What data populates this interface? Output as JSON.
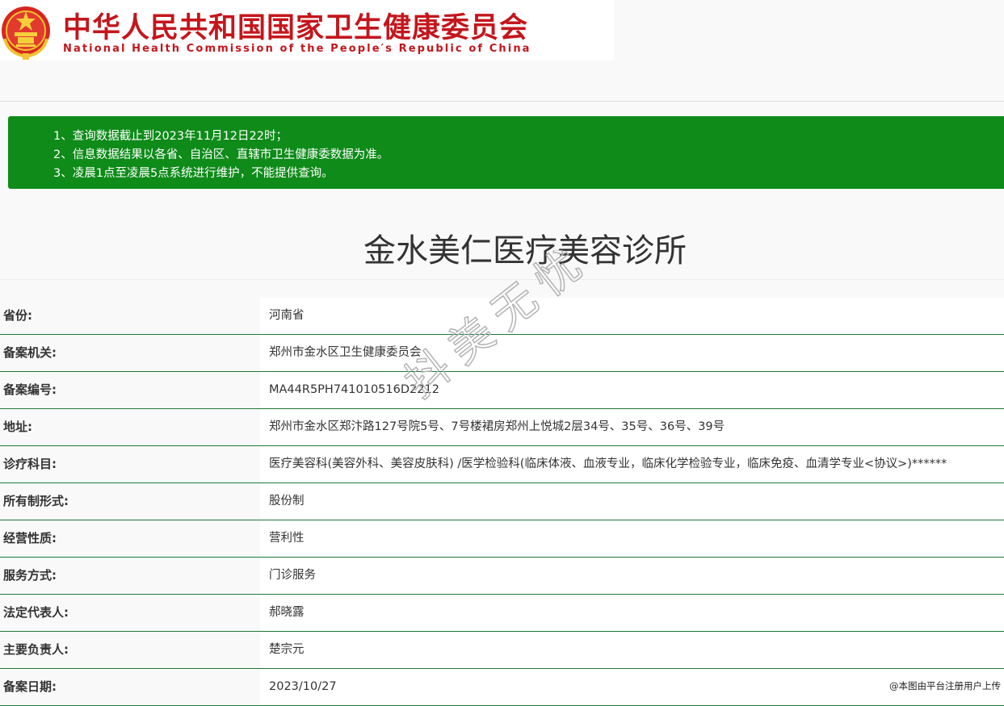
{
  "header": {
    "title_cn": "中华人民共和国国家卫生健康委员会",
    "title_en": "National Health Commission of the People′s Republic of China",
    "emblem_icon": "national-emblem-icon",
    "color": "#c4161c"
  },
  "notice": {
    "color": "#0e8b19",
    "lines": [
      "1、查询数据截止到2023年11月12日22时；",
      "2、信息数据结果以各省、自治区、直辖市卫生健康委数据为准。",
      "3、凌晨1点至凌晨5点系统进行维护，不能提供查询。"
    ]
  },
  "org_name": "金水美仁医疗美容诊所",
  "watermark": "抖美无忧",
  "credit": "@本图由平台注册用户上传",
  "fields": [
    {
      "label": "省份:",
      "value": "河南省"
    },
    {
      "label": "备案机关:",
      "value": "郑州市金水区卫生健康委员会"
    },
    {
      "label": "备案编号:",
      "value": "MA44R5PH741010516D2212"
    },
    {
      "label": "地址:",
      "value": "郑州市金水区郑汴路127号院5号、7号楼裙房郑州上悦城2层34号、35号、36号、39号"
    },
    {
      "label": "诊疗科目:",
      "value": "医疗美容科(美容外科、美容皮肤科) /医学检验科(临床体液、血液专业，临床化学检验专业，临床免疫、血清学专业<协议>)******"
    },
    {
      "label": "所有制形式:",
      "value": "股份制"
    },
    {
      "label": "经营性质:",
      "value": "营利性"
    },
    {
      "label": "服务方式:",
      "value": "门诊服务"
    },
    {
      "label": "法定代表人:",
      "value": "郝晓露"
    },
    {
      "label": "主要负责人:",
      "value": "楚宗元"
    },
    {
      "label": "备案日期:",
      "value": "2023/10/27"
    }
  ]
}
